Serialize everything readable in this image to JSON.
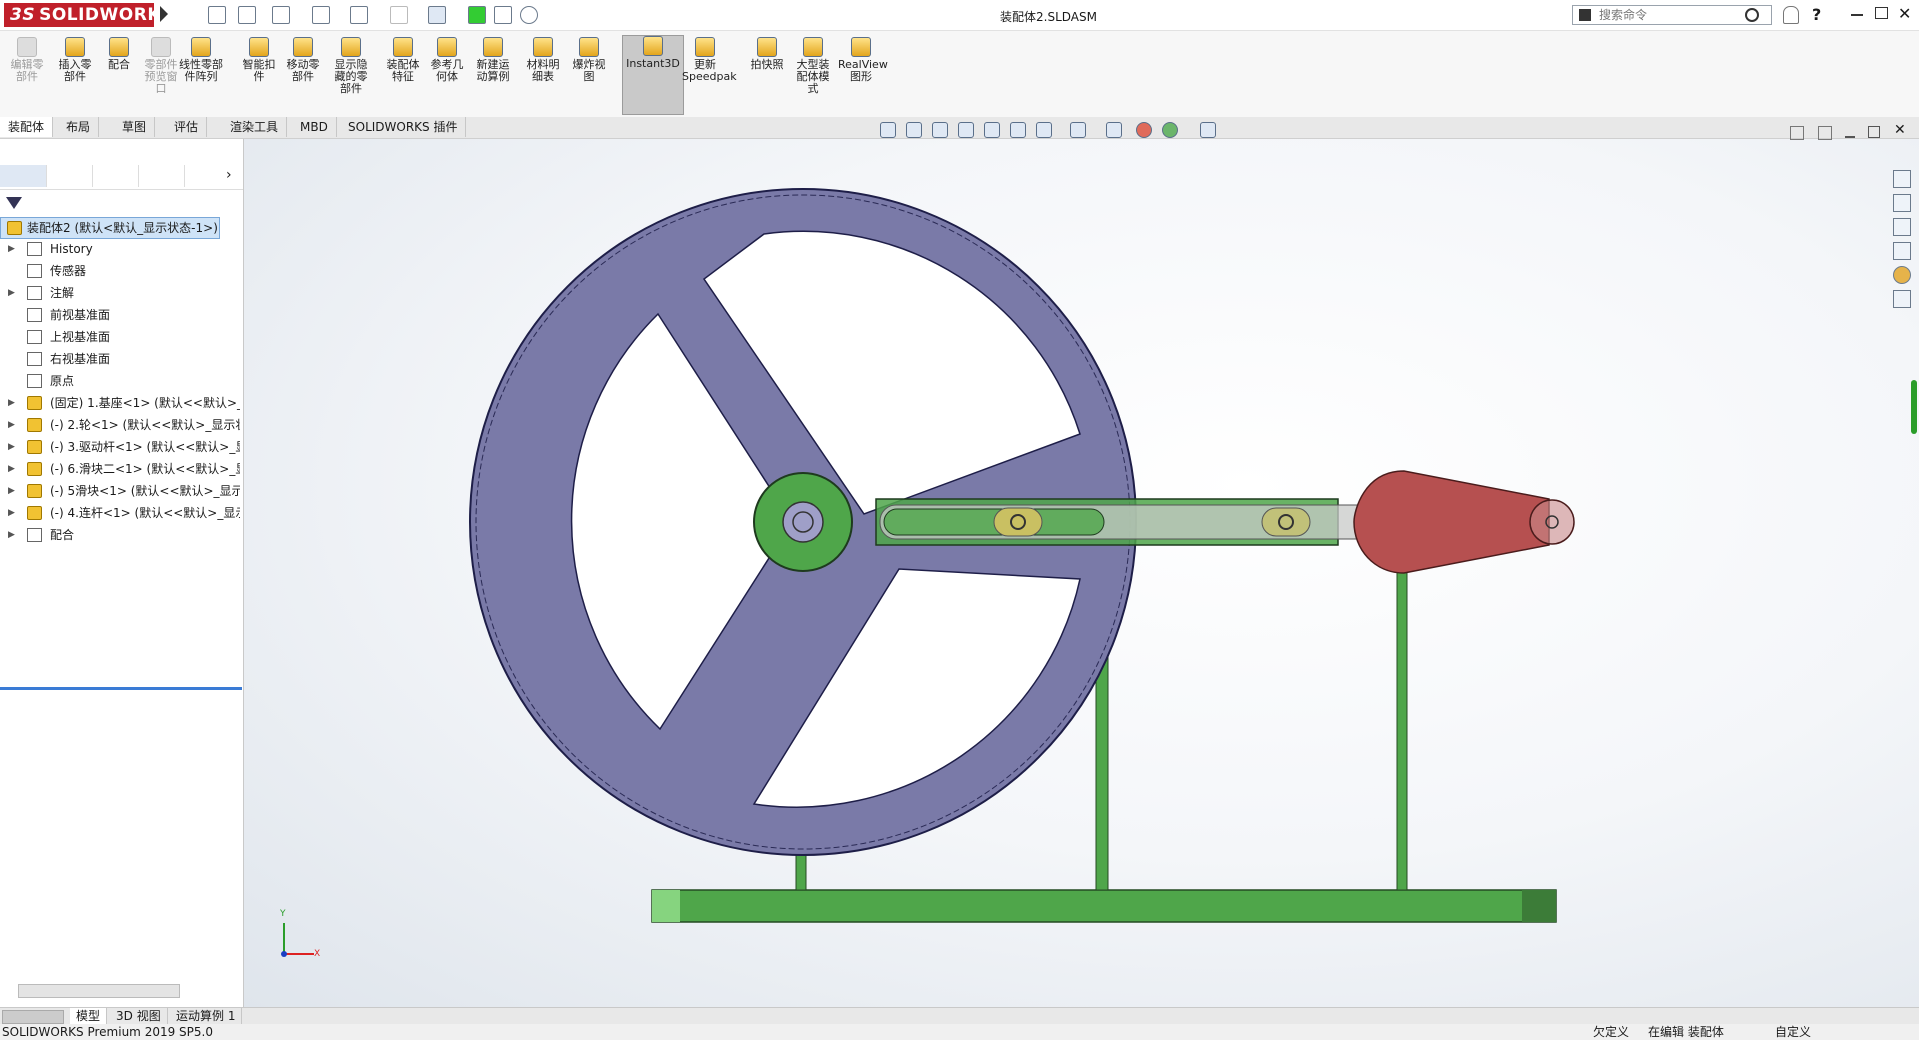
{
  "app": {
    "brand_ds": "3S",
    "brand": "SOLIDWORKS",
    "document_title": "装配体2.SLDASM",
    "search_placeholder": "搜索命令"
  },
  "commands": [
    {
      "label": "编辑零\n部件",
      "disabled": true
    },
    {
      "label": "插入零\n部件",
      "disabled": false
    },
    {
      "label": "配合",
      "disabled": false
    },
    {
      "label": "零部件\n预览窗\n口",
      "disabled": true
    },
    {
      "label": "线性零部\n件阵列",
      "disabled": false
    },
    {
      "label": "智能扣\n件",
      "disabled": false
    },
    {
      "label": "移动零\n部件",
      "disabled": false
    },
    {
      "label": "显示隐\n藏的零\n部件",
      "disabled": false
    },
    {
      "label": "装配体\n特征",
      "disabled": false
    },
    {
      "label": "参考几\n何体",
      "disabled": false
    },
    {
      "label": "新建运\n动算例",
      "disabled": false
    },
    {
      "label": "材料明\n细表",
      "disabled": false
    },
    {
      "label": "爆炸视\n图",
      "disabled": false
    },
    {
      "label": "Instant3D",
      "disabled": false
    },
    {
      "label": "更新\nSpeedpak",
      "disabled": false
    },
    {
      "label": "拍快照",
      "disabled": false
    },
    {
      "label": "大型装\n配体模\n式",
      "disabled": false
    },
    {
      "label": "RealView\n图形",
      "disabled": false
    }
  ],
  "tabs": [
    "装配体",
    "布局",
    "草图",
    "评估",
    "渲染工具",
    "MBD",
    "SOLIDWORKS 插件"
  ],
  "tree": {
    "root": "装配体2 (默认<默认_显示状态-1>)",
    "items": [
      {
        "label": "History",
        "expandable": true,
        "kind": "history"
      },
      {
        "label": "传感器",
        "expandable": false,
        "kind": "sensor"
      },
      {
        "label": "注解",
        "expandable": true,
        "kind": "annotation"
      },
      {
        "label": "前视基准面",
        "expandable": false,
        "kind": "plane"
      },
      {
        "label": "上视基准面",
        "expandable": false,
        "kind": "plane"
      },
      {
        "label": "右视基准面",
        "expandable": false,
        "kind": "plane"
      },
      {
        "label": "原点",
        "expandable": false,
        "kind": "origin"
      },
      {
        "label": "(固定) 1.基座<1> (默认<<默认>_显",
        "expandable": true,
        "kind": "part"
      },
      {
        "label": "(-) 2.轮<1> (默认<<默认>_显示状",
        "expandable": true,
        "kind": "part"
      },
      {
        "label": "(-) 3.驱动杆<1> (默认<<默认>_显",
        "expandable": true,
        "kind": "part"
      },
      {
        "label": "(-) 6.滑块二<1> (默认<<默认>_显",
        "expandable": true,
        "kind": "part"
      },
      {
        "label": "(-) 5滑块<1> (默认<<默认>_显示",
        "expandable": true,
        "kind": "part"
      },
      {
        "label": "(-) 4.连杆<1> (默认<<默认>_显示",
        "expandable": true,
        "kind": "part"
      },
      {
        "label": "配合",
        "expandable": true,
        "kind": "mates"
      }
    ]
  },
  "bottom_tabs": [
    "模型",
    "3D 视图",
    "运动算例 1"
  ],
  "status": {
    "product": "SOLIDWORKS Premium 2019 SP5.0",
    "state": "欠定义",
    "editing": "在编辑 装配体",
    "custom": "自定义"
  },
  "triad": {
    "x": "X",
    "y": "Y"
  },
  "colors": {
    "wheel": "#7a7aa8",
    "frame_green": "#4fa64a",
    "crank_red": "#b65050",
    "slider_yellow": "#c9c062",
    "brand_red": "#c0202a"
  }
}
